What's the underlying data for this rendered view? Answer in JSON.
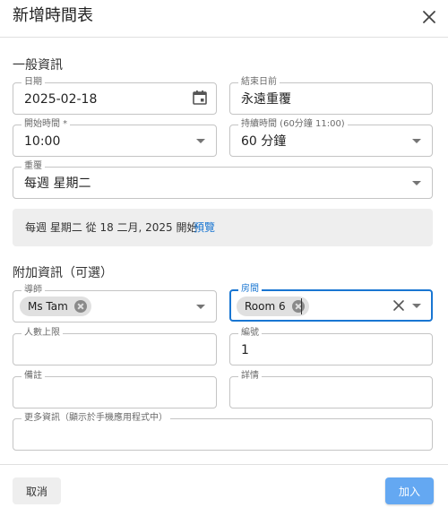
{
  "dialog": {
    "title": "新增時間表"
  },
  "general": {
    "section_title": "一般資訊",
    "date": {
      "label": "日期",
      "value": "2025-02-18"
    },
    "end_date": {
      "label": "結束日前",
      "value": "永遠重覆"
    },
    "start_time": {
      "label": "開始時間 *",
      "value": "10:00"
    },
    "duration": {
      "label": "持續時間 (60分鐘 11:00)",
      "value": "60 分鐘"
    },
    "repeat": {
      "label": "重覆",
      "value": "每週 星期二"
    },
    "summary": {
      "text": "每週 星期二 從 18 二月, 2025 開始",
      "preview_link": "預覽"
    }
  },
  "additional": {
    "section_title": "附加資訊（可選）",
    "instructor": {
      "label": "導師",
      "chip": "Ms Tam"
    },
    "room": {
      "label": "房間",
      "chip": "Room 6"
    },
    "max_people": {
      "label": "人數上限",
      "value": ""
    },
    "number": {
      "label": "編號",
      "value": "1"
    },
    "remarks": {
      "label": "備註",
      "value": ""
    },
    "details": {
      "label": "詳情",
      "value": ""
    },
    "more_info": {
      "label": "更多資訊（顯示於手機應用程式中）",
      "value": ""
    }
  },
  "footer": {
    "cancel_label": "取消",
    "add_label": "加入"
  },
  "colors": {
    "accent": "#1976d2",
    "add_button": "#64a8f2",
    "summary_bg": "#eeeeee"
  }
}
